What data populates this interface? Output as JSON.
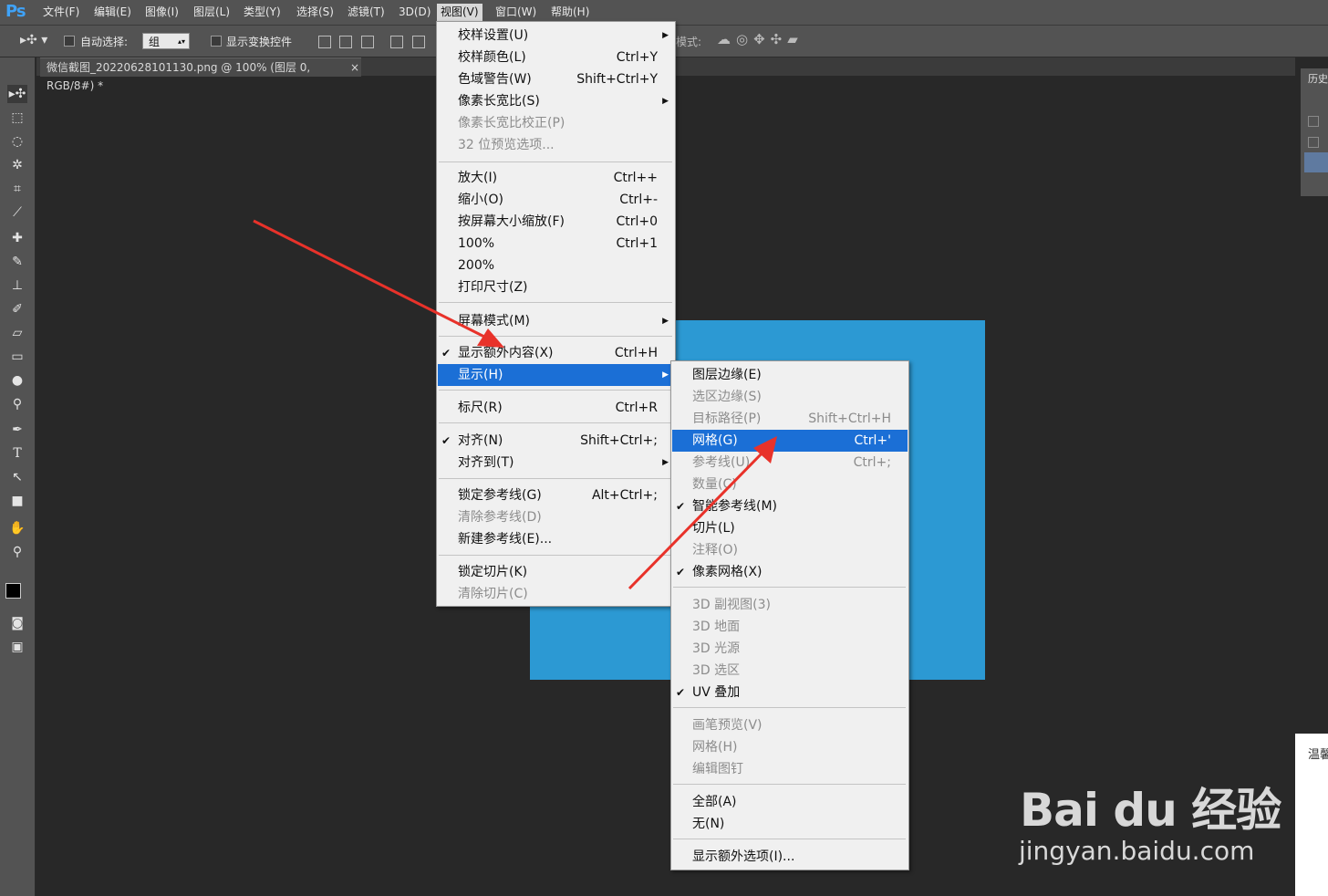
{
  "app": {
    "logo": "Ps"
  },
  "menubar": {
    "items": [
      "文件(F)",
      "编辑(E)",
      "图像(I)",
      "图层(L)",
      "类型(Y)",
      "选择(S)",
      "滤镜(T)",
      "3D(D)",
      "视图(V)",
      "窗口(W)",
      "帮助(H)"
    ],
    "active": "视图(V)"
  },
  "options": {
    "auto_select_label": "自动选择:",
    "auto_select_value": "组",
    "show_transform_label": "显示变换控件",
    "mode_label": "模式:"
  },
  "document": {
    "tab_title": "微信截图_20220628101130.png @ 100% (图层 0, RGB/8#) *",
    "close": "×"
  },
  "right_panel": {
    "title": "历史"
  },
  "view_menu": {
    "items": [
      {
        "label": "校样设置(U)",
        "shortcut": "",
        "submenu": true,
        "disabled": false,
        "checked": false
      },
      {
        "label": "校样颜色(L)",
        "shortcut": "Ctrl+Y",
        "disabled": false
      },
      {
        "label": "色域警告(W)",
        "shortcut": "Shift+Ctrl+Y",
        "disabled": false
      },
      {
        "label": "像素长宽比(S)",
        "shortcut": "",
        "submenu": true,
        "disabled": false
      },
      {
        "label": "像素长宽比校正(P)",
        "shortcut": "",
        "disabled": true
      },
      {
        "label": "32 位预览选项...",
        "shortcut": "",
        "disabled": true
      },
      {
        "label": "放大(I)",
        "shortcut": "Ctrl++",
        "disabled": false
      },
      {
        "label": "缩小(O)",
        "shortcut": "Ctrl+-",
        "disabled": false
      },
      {
        "label": "按屏幕大小缩放(F)",
        "shortcut": "Ctrl+0",
        "disabled": false
      },
      {
        "label": "100%",
        "shortcut": "Ctrl+1",
        "disabled": false
      },
      {
        "label": "200%",
        "shortcut": "",
        "disabled": false
      },
      {
        "label": "打印尺寸(Z)",
        "shortcut": "",
        "disabled": false
      },
      {
        "label": "屏幕模式(M)",
        "shortcut": "",
        "submenu": true,
        "disabled": false
      },
      {
        "label": "显示额外内容(X)",
        "shortcut": "Ctrl+H",
        "checked": true,
        "disabled": false
      },
      {
        "label": "显示(H)",
        "shortcut": "",
        "submenu": true,
        "highlighted": true,
        "disabled": false
      },
      {
        "label": "标尺(R)",
        "shortcut": "Ctrl+R",
        "disabled": false
      },
      {
        "label": "对齐(N)",
        "shortcut": "Shift+Ctrl+;",
        "checked": true,
        "disabled": false
      },
      {
        "label": "对齐到(T)",
        "shortcut": "",
        "submenu": true,
        "disabled": false
      },
      {
        "label": "锁定参考线(G)",
        "shortcut": "Alt+Ctrl+;",
        "disabled": false
      },
      {
        "label": "清除参考线(D)",
        "shortcut": "",
        "disabled": true
      },
      {
        "label": "新建参考线(E)...",
        "shortcut": "",
        "disabled": false
      },
      {
        "label": "锁定切片(K)",
        "shortcut": "",
        "disabled": false
      },
      {
        "label": "清除切片(C)",
        "shortcut": "",
        "disabled": true
      }
    ]
  },
  "show_submenu": {
    "items": [
      {
        "label": "图层边缘(E)",
        "shortcut": "",
        "disabled": false
      },
      {
        "label": "选区边缘(S)",
        "shortcut": "",
        "disabled": true
      },
      {
        "label": "目标路径(P)",
        "shortcut": "Shift+Ctrl+H",
        "disabled": true
      },
      {
        "label": "网格(G)",
        "shortcut": "Ctrl+'",
        "highlighted": true,
        "disabled": false
      },
      {
        "label": "参考线(U)",
        "shortcut": "Ctrl+;",
        "disabled": true
      },
      {
        "label": "数量(C)",
        "shortcut": "",
        "disabled": true
      },
      {
        "label": "智能参考线(M)",
        "shortcut": "",
        "checked": true,
        "disabled": false
      },
      {
        "label": "切片(L)",
        "shortcut": "",
        "disabled": false
      },
      {
        "label": "注释(O)",
        "shortcut": "",
        "disabled": true
      },
      {
        "label": "像素网格(X)",
        "shortcut": "",
        "checked": true,
        "disabled": false
      },
      {
        "label": "3D 副视图(3)",
        "shortcut": "",
        "disabled": true
      },
      {
        "label": "3D 地面",
        "shortcut": "",
        "disabled": true
      },
      {
        "label": "3D 光源",
        "shortcut": "",
        "disabled": true
      },
      {
        "label": "3D 选区",
        "shortcut": "",
        "disabled": true
      },
      {
        "label": "UV 叠加",
        "shortcut": "",
        "checked": true,
        "disabled": false
      },
      {
        "label": "画笔预览(V)",
        "shortcut": "",
        "disabled": true
      },
      {
        "label": "网格(H)",
        "shortcut": "",
        "disabled": true
      },
      {
        "label": "编辑图钉",
        "shortcut": "",
        "disabled": true
      },
      {
        "label": "全部(A)",
        "shortcut": "",
        "disabled": false
      },
      {
        "label": "无(N)",
        "shortcut": "",
        "disabled": false
      },
      {
        "label": "显示额外选项(I)...",
        "shortcut": "",
        "disabled": false
      }
    ]
  },
  "watermark": {
    "brand": "Bai du 经验",
    "url": "jingyan.baidu.com"
  },
  "notification": {
    "text": "温馨"
  },
  "colors": {
    "accent": "#1b6fd6",
    "canvas_image": "#2c99d3",
    "arrow": "#e8322a"
  }
}
